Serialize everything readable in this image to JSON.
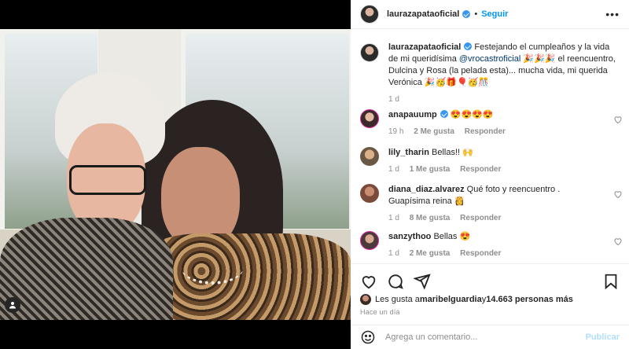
{
  "post": {
    "username": "laurazapataoficial",
    "follow_label": "Seguir",
    "more_label": "•••",
    "dot": "•"
  },
  "caption": {
    "username": "laurazapataoficial",
    "text_before": " Festejando el cumpleaños y la vida de mi queridísima ",
    "mention": "@vrocastroficial",
    "text_after": " 🎉🎉🎉 el reencuentro, Dulcina y Rosa (la pelada esta)... mucha vida, mi querida Verónica 🎉🥳🎁🎈🥳🎊",
    "time": "1 d"
  },
  "comments": [
    {
      "username": "anapauump",
      "verified": true,
      "text": " 😍😍😍😍",
      "time": "19 h",
      "likes": "2 Me gusta",
      "reply": "Responder",
      "avatar_color": "#3a2a2a"
    },
    {
      "username": "lily_tharin",
      "verified": false,
      "text": " Bellas!! 🙌",
      "time": "1 d",
      "likes": "1 Me gusta",
      "reply": "Responder",
      "avatar_color": "#6b5844"
    },
    {
      "username": "diana_diaz.alvarez",
      "verified": false,
      "text": " Qué foto y reencuentro . Guapísima reina 👸",
      "time": "1 d",
      "likes": "8 Me gusta",
      "reply": "Responder",
      "avatar_color": "#7a4a3a"
    },
    {
      "username": "sanzythoo",
      "verified": false,
      "text": " Bellas 😍",
      "time": "1 d",
      "likes": "2 Me gusta",
      "reply": "Responder",
      "avatar_color": "#4a3a3a"
    }
  ],
  "likes_line": {
    "prefix": "Les gusta a ",
    "user": "maribelguardia",
    "middle": " y ",
    "count": "14.663 personas más"
  },
  "post_time": "Hace un día",
  "comment_box": {
    "placeholder": "Agrega un comentario...",
    "publish_label": "Publicar"
  },
  "colors": {
    "accent": "#0095f6",
    "verified": "#3897f0",
    "publish_disabled": "#b2dffc"
  },
  "icons": [
    "tag-icon",
    "verified-icon",
    "more-icon",
    "heart-icon",
    "comment-icon",
    "share-icon",
    "bookmark-icon",
    "emoji-icon"
  ]
}
